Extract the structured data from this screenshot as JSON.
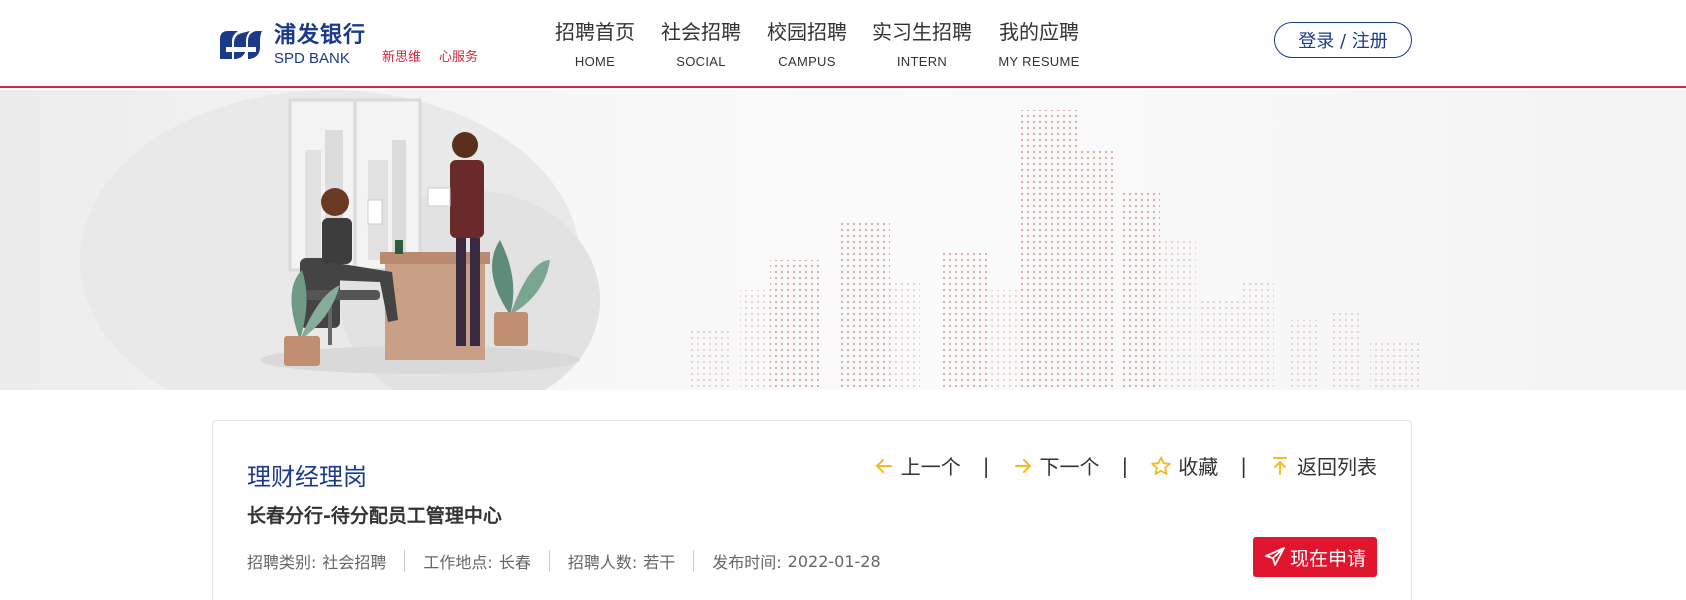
{
  "header": {
    "logo_cn": "浦发银行",
    "logo_en": "SPD BANK",
    "slogan": [
      "新思维",
      "心服务"
    ],
    "nav": [
      {
        "cn": "招聘首页",
        "en": "HOME"
      },
      {
        "cn": "社会招聘",
        "en": "SOCIAL"
      },
      {
        "cn": "校园招聘",
        "en": "CAMPUS"
      },
      {
        "cn": "实习生招聘",
        "en": "INTERN"
      },
      {
        "cn": "我的应聘",
        "en": "MY RESUME"
      }
    ],
    "login_label": "登录 / 注册"
  },
  "job": {
    "title": "理财经理岗",
    "department": "长春分行-待分配员工管理中心",
    "meta": [
      {
        "label": "招聘类别:",
        "value": "社会招聘"
      },
      {
        "label": "工作地点:",
        "value": "长春"
      },
      {
        "label": "招聘人数:",
        "value": "若干"
      },
      {
        "label": "发布时间:",
        "value": "2022-01-28"
      }
    ],
    "actions": {
      "prev": "上一个",
      "next": "下一个",
      "favorite": "收藏",
      "back": "返回列表",
      "separator": "|"
    },
    "apply_label": "现在申请"
  },
  "icons": {
    "prev": "arrow-left-icon",
    "next": "arrow-right-icon",
    "favorite": "star-icon",
    "back": "arrow-up-icon",
    "apply": "paper-plane-icon"
  },
  "colors": {
    "brand_blue": "#1b3a8a",
    "accent_red": "#e1162e",
    "icon_yellow": "#f5b925"
  }
}
